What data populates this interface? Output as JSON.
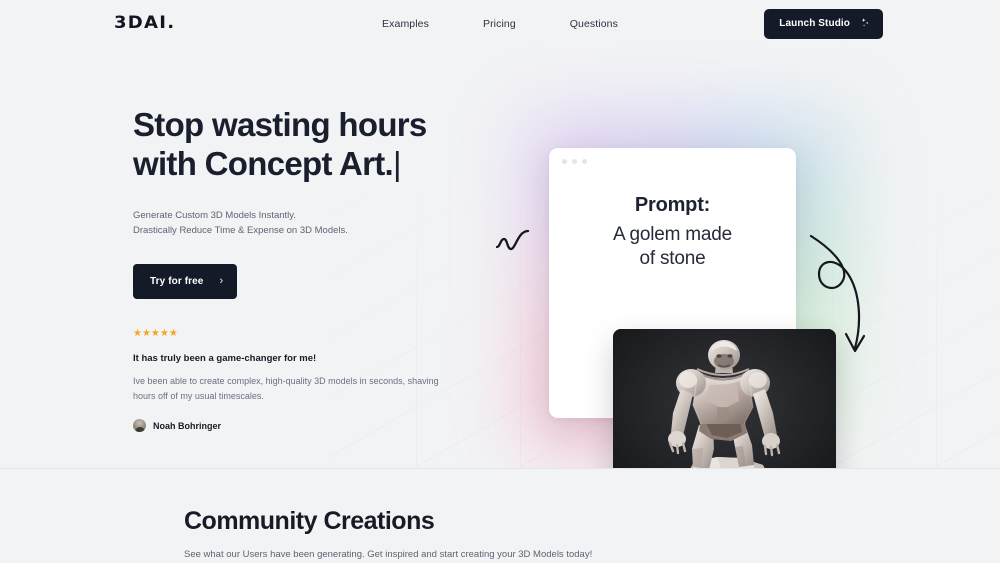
{
  "header": {
    "logo": "3DAI.",
    "nav": [
      {
        "label": "Examples"
      },
      {
        "label": "Pricing"
      },
      {
        "label": "Questions"
      }
    ],
    "cta": {
      "label": "Launch Studio",
      "icon": "sparkle-icon"
    }
  },
  "hero": {
    "headline_line1": "Stop wasting hours",
    "headline_line2": "with Concept Art.",
    "caret": "|",
    "sub_line1": "Generate Custom 3D Models Instantly.",
    "sub_line2": "Drastically Reduce Time & Expense on 3D Models.",
    "cta": {
      "label": "Try for free",
      "icon": "chevron-right-icon"
    },
    "testimonial": {
      "stars": "★★★★★",
      "star_count": 5,
      "star_color": "#f5a623",
      "title": "It has truly been a game-changer for me!",
      "body": "Ive been able to create complex, high-quality 3D models in seconds, shaving hours off of my usual timescales.",
      "author": "Noah Bohringer"
    },
    "prompt_card": {
      "label": "Prompt:",
      "value_line1": "A golem made",
      "value_line2": "of stone"
    },
    "preview_card": {
      "alt": "3D rendered stone golem standing on rocks"
    },
    "doodles": {
      "squiggle": "zigzag-doodle",
      "arrow": "curved-arrow-doodle"
    }
  },
  "community": {
    "title": "Community Creations",
    "subtitle": "See what our Users have been generating. Get inspired and start creating your 3D Models today!"
  },
  "colors": {
    "background": "#f2f3f5",
    "text_dark": "#171b26",
    "text_muted": "#5d6373",
    "button_dark": "#151a29",
    "star": "#f5a623",
    "divider": "#e4e6ea"
  }
}
